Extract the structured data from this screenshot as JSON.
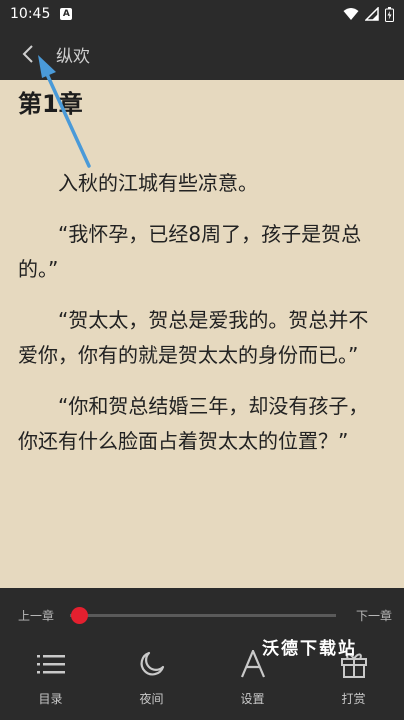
{
  "status_bar": {
    "time": "10:45",
    "notification_letter": "A"
  },
  "toolbar": {
    "book_title": "纵欢"
  },
  "reader": {
    "chapter_title": "第1章",
    "paragraphs": [
      "入秋的江城有些凉意。",
      "“我怀孕，已经8周了，孩子是贺总的。”",
      "“贺太太，贺总是爱我的。贺总并不爱你，你有的就是贺太太的身份而已。”",
      "“你和贺总结婚三年，却没有孩子，你还有什么脸面占着贺太太的位置？”"
    ]
  },
  "progress": {
    "prev_label": "上一章",
    "next_label": "下一章",
    "value": 0.02
  },
  "nav": {
    "items": [
      {
        "label": "目录",
        "icon": "list-icon"
      },
      {
        "label": "夜间",
        "icon": "moon-icon"
      },
      {
        "label": "设置",
        "icon": "font-icon"
      },
      {
        "label": "打赏",
        "icon": "gift-icon"
      }
    ]
  },
  "watermark": "沃德下载站",
  "colors": {
    "page_background": "#e6d9bf",
    "bar_background": "#2b2b2b",
    "slider_thumb": "#e4202f",
    "annotation_arrow": "#4a9ad8"
  }
}
